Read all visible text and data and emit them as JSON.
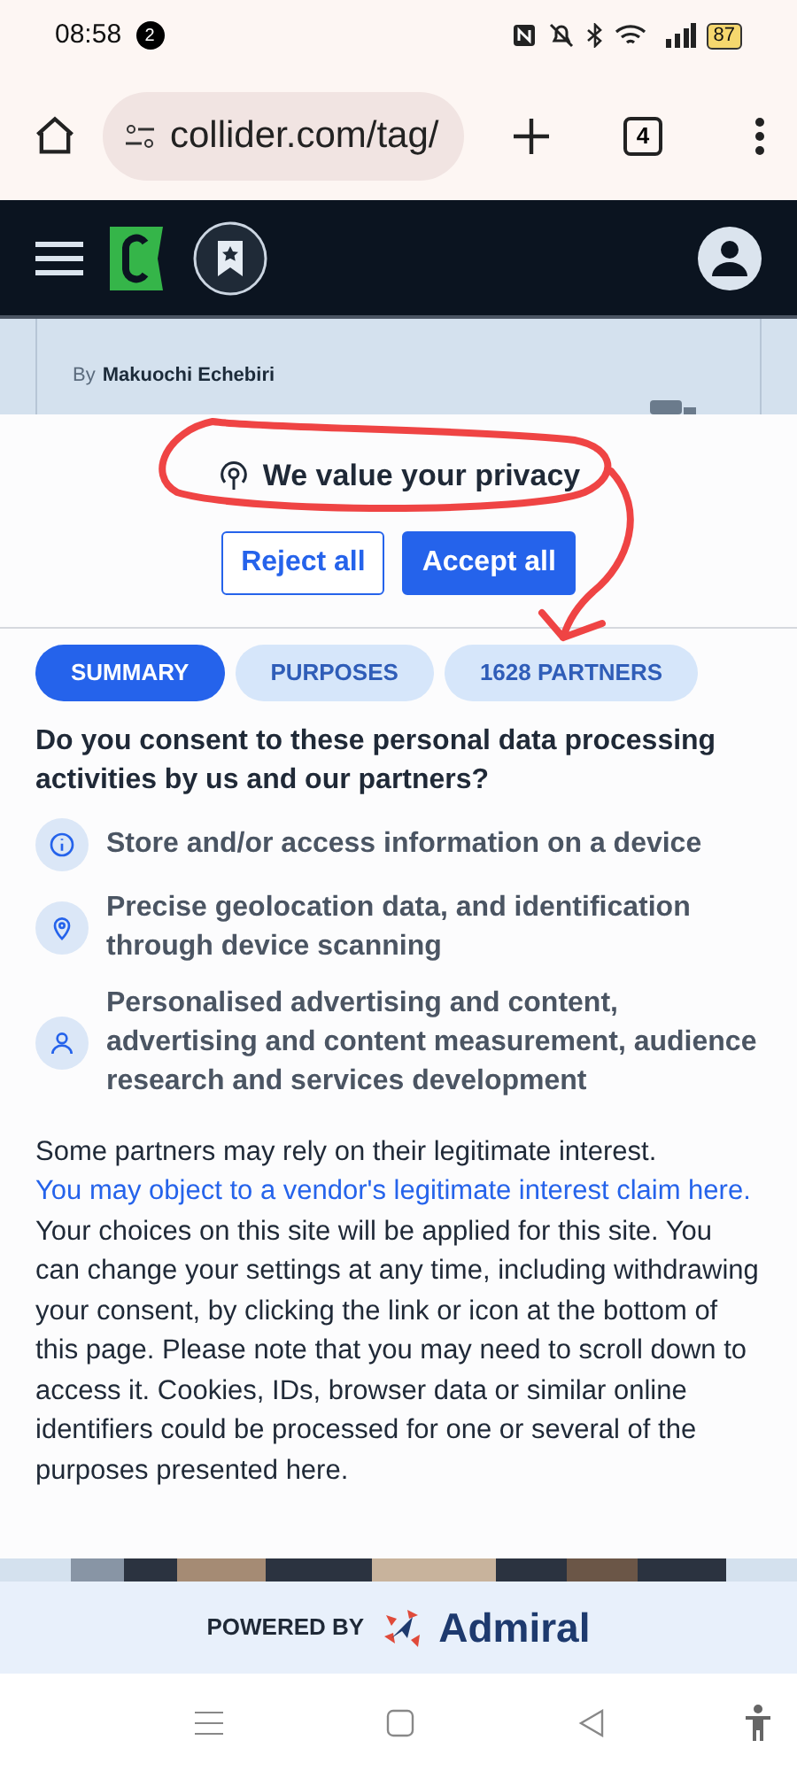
{
  "status_bar": {
    "time": "08:58",
    "notification_count": "2",
    "battery": "87"
  },
  "browser": {
    "url": "collider.com/tag/",
    "tab_count": "4"
  },
  "article": {
    "byline_prefix": "By",
    "author": "Makuochi Echebiri"
  },
  "consent": {
    "title": "We value your privacy",
    "buttons": [
      {
        "label": "Reject all",
        "kind": "outline"
      },
      {
        "label": "Accept all",
        "kind": "filled"
      }
    ],
    "tabs": [
      {
        "label": "SUMMARY",
        "selected": true
      },
      {
        "label": "PURPOSES",
        "selected": false
      },
      {
        "label": "1628 PARTNERS",
        "selected": false
      }
    ],
    "question": "Do you consent to these personal data processing activities by us and our partners?",
    "purposes": [
      {
        "kind": "info",
        "text": "Store and/or access information on a device"
      },
      {
        "kind": "location",
        "text": "Precise geolocation data, and identification through device scanning"
      },
      {
        "kind": "person",
        "text": "Personalised advertising and content, advertising and content measurement, audience research and services development"
      }
    ],
    "body_before_link": "Some partners may rely on their legitimate interest.",
    "link": "You may object to a vendor's legitimate interest claim here.",
    "body_after_link": "Your choices on this site will be applied for this site. You can change your settings at any time, including withdrawing your consent, by clicking the link or icon at the bottom of this page. Please note that you may need to scroll down to access it. Cookies, IDs, browser data or similar online identifiers could be processed for one or several of the purposes presented here."
  },
  "footer": {
    "powered_by": "POWERED BY",
    "brand": "Admiral"
  }
}
